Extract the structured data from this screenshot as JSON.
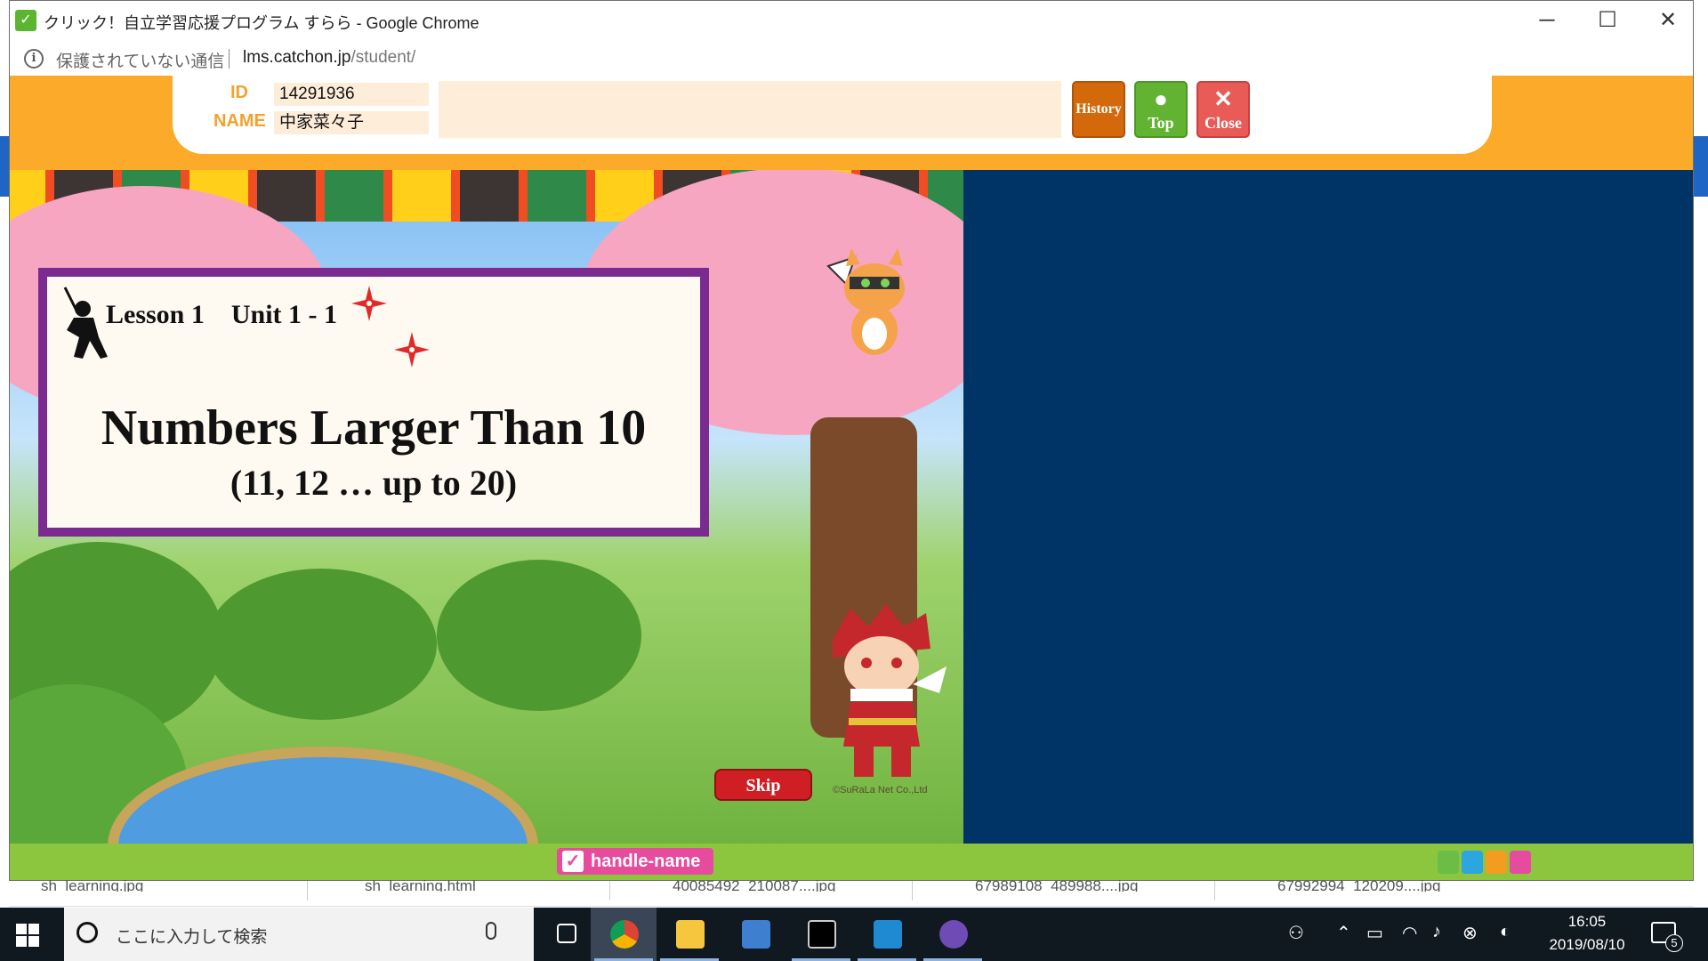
{
  "window": {
    "title": "クリック！自立学習応援プログラム すらら - Google Chrome",
    "app_icon": "surala-check-icon",
    "controls": {
      "minimize": "─",
      "maximize": "☐",
      "close": "✕"
    }
  },
  "addressbar": {
    "security_text": "保護されていない通信",
    "url_host": "lms.catchon.jp",
    "url_path": "/student/"
  },
  "header": {
    "id_label": "ID",
    "id_value": "14291936",
    "name_label": "NAME",
    "name_value": "中家菜々子",
    "buttons": {
      "history": "History",
      "top": "Top",
      "close": "Close"
    },
    "colors": {
      "band": "#fbaa2a",
      "history": "#d4690b",
      "top": "#62b332",
      "close": "#e85b57"
    }
  },
  "lesson": {
    "heading": "Lesson 1    Unit 1 - 1",
    "title": "Numbers Larger Than 10",
    "subtitle": "(11, 12 … up to 20)",
    "skip_label": "Skip",
    "copyright": "©SuRaLa Net Co.,Ltd",
    "border_color": "#7b2b90"
  },
  "side_panel": {
    "color": "#003366"
  },
  "bottom_bar": {
    "handle_name": "handle-name",
    "brand_logo": "surala-logo"
  },
  "downloads": [
    "sh_learning.jpg",
    "sh_learning.html",
    "40085492_210087....jpg",
    "67989108_489988....jpg",
    "67992994_120209....jpg"
  ],
  "taskbar": {
    "search_placeholder": "ここに入力して検索",
    "apps": [
      "task-view-icon",
      "chrome-icon",
      "file-explorer-icon",
      "remote-desktop-icon",
      "terminal-icon",
      "vscode-icon",
      "github-icon"
    ],
    "time": "16:05",
    "date": "2019/08/10",
    "notification_count": "5"
  }
}
